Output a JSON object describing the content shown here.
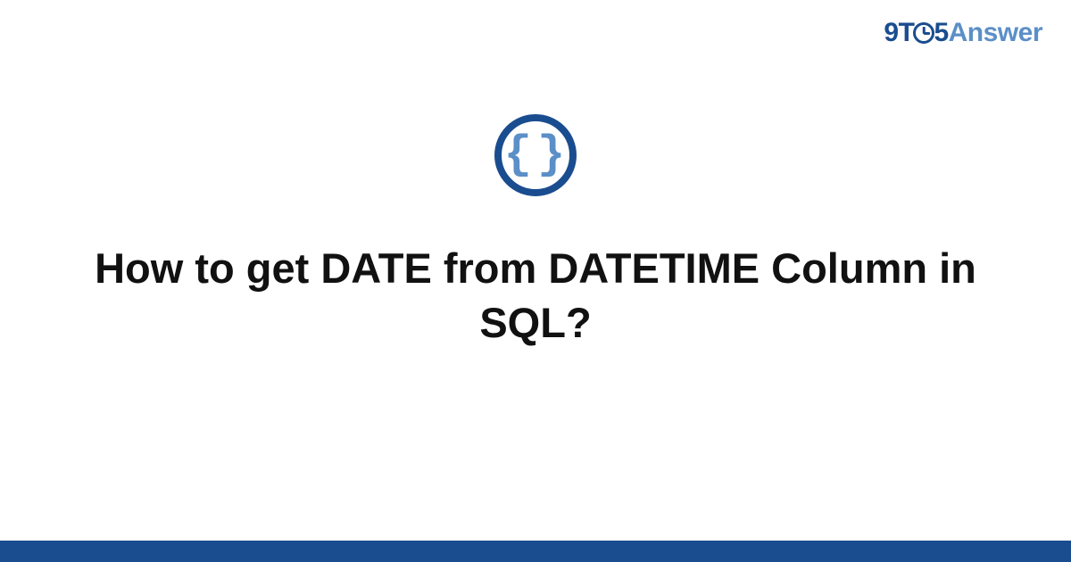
{
  "logo": {
    "part1": "9T",
    "part2": "5",
    "part3": "Answer"
  },
  "icon": {
    "symbol": "{}",
    "name": "code-braces"
  },
  "title": "How to get DATE from DATETIME Column in SQL?",
  "colors": {
    "primary": "#1a4d8f",
    "secondary": "#5b8fc7"
  }
}
